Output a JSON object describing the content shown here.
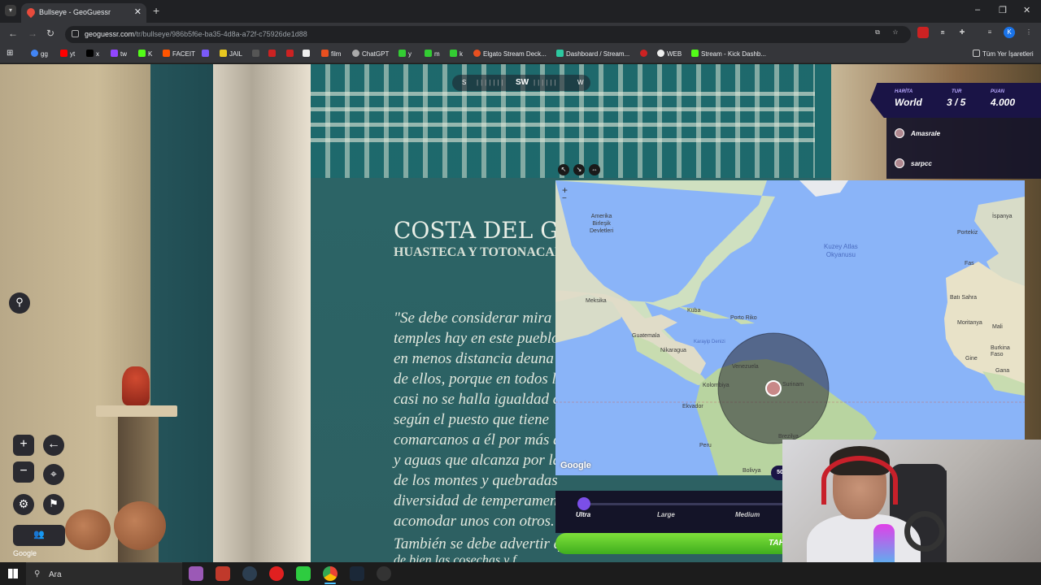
{
  "browser": {
    "tab_title": "Bullseye - GeoGuessr",
    "url_host": "geoguessr.com",
    "url_path": "/tr/bullseye/986b5f6e-ba35-4d8a-a72f-c75926de1d88",
    "new_tab": "+",
    "close_tab": "✕",
    "minimize": "–",
    "restore": "❐",
    "close_window": "✕",
    "profile_initial": "K",
    "bookmarks": [
      "gg",
      "yt",
      "x",
      "tw",
      "K",
      "FACEIT",
      "JAIL",
      "film",
      "ChatGPT",
      "y",
      "m",
      "k",
      "Elgato Stream Deck...",
      "Dashboard / Stream...",
      "WEB",
      "Stream - Kick Dashb..."
    ],
    "all_bookmarks": "Tüm Yer İşaretleri"
  },
  "streetview": {
    "title": "COSTA DEL GOLFO",
    "subtitle": "HUASTECA Y TOTONACAPAN",
    "lines": [
      "\"Se debe considerar mira",
      "temples hay en este pueblo",
      "en menos distancia deuna",
      "de ellos, porque en todos l",
      "casi no se halla igualdad de",
      "según el puesto que tiene",
      "comarcanos a él por más a",
      "y aguas que alcanza por la",
      "de los montes y quebradas",
      "diversidad de temperamentos",
      "acomodar unos con otros.",
      "También se debe advertir q",
      "de bien las cosechas y f"
    ],
    "compass": {
      "s": "S",
      "sw": "SW",
      "w": "W"
    },
    "google": "Google"
  },
  "controls": {
    "zoom_in": "+",
    "zoom_out": "−",
    "back": "←",
    "pin": "⌖",
    "settings": "⚙",
    "flag": "⚑"
  },
  "scoreboard": {
    "map_label": "HARİTA",
    "map_value": "World",
    "round_label": "TUR",
    "round_value": "3 / 5",
    "score_label": "PUAN",
    "score_value": "4.000"
  },
  "players": [
    "Amasrale",
    "sarpcc"
  ],
  "map": {
    "labels": {
      "usa": "Amerika\nBirleşik\nDevletleri",
      "mexico": "Meksika",
      "cuba": "Küba",
      "pr": "Porto Riko",
      "guatemala": "Guatemala",
      "nicaragua": "Nikaragua",
      "caribbean": "Karayip Denizi",
      "venezuela": "Venezuela",
      "colombia": "Kolombiya",
      "suriname": "Surinam",
      "ecuador": "Ekvador",
      "peru": "Peru",
      "brazil": "Brezilya",
      "bolivia": "Bolivya",
      "atlantic": "Kuzey Atlas\nOkyanusu",
      "spain": "İspanya",
      "portugal": "Portekiz",
      "morocco": "Fas",
      "sahara": "Batı Sahra",
      "mauritania": "Moritanya",
      "mali": "Mali",
      "guinea": "Gine",
      "burkina": "Burkina\nFaso",
      "ghana": "Gana"
    },
    "google": "Google",
    "zoom_in": "+",
    "zoom_out": "−",
    "score_chip": "50"
  },
  "map_size": {
    "options": [
      "Ultra",
      "Large",
      "Medium"
    ],
    "selected": "Ultra"
  },
  "guess_button": "TAH",
  "taskbar": {
    "search_placeholder": "Ara"
  }
}
